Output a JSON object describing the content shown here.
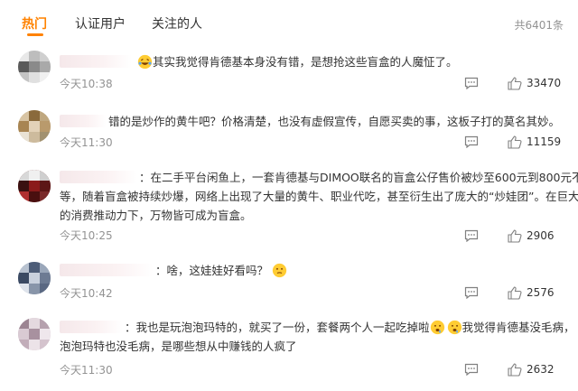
{
  "tabs": {
    "hot": "热门",
    "verified": "认证用户",
    "following": "关注的人"
  },
  "total": "共6401条",
  "comments": [
    {
      "text": "其实我觉得肯德基本身没有错，是想抢这些盲盒的人魔怔了。",
      "time": "今天10:38",
      "likes": "33470",
      "emoji": "laughing-tears-icon"
    },
    {
      "text": "错的是炒作的黄牛吧？价格清楚，也没有虚假宣传，自愿买卖的事，这板子打的莫名其妙。",
      "time": "今天11:30",
      "likes": "11159"
    },
    {
      "line1": "：在二手平台闲鱼上，一套肯德基与DIMOO联名的盲盒公仔售价被炒至600元到800元不",
      "line2": "等，随着盲盒被持续炒爆，网络上出现了大量的黄牛、职业代吃，甚至衍生出了庞大的“炒娃团”。在巨大",
      "line3": "的消费推动力下，万物皆可成为盲盒。",
      "time": "今天10:25",
      "likes": "2906"
    },
    {
      "text": "：啥，这娃娃好看吗？",
      "time": "今天10:42",
      "likes": "2576",
      "emoji": "thinking-face-icon"
    },
    {
      "line1a": "：我也是玩泡泡玛特的，就买了一份，套餐两个人一起吃掉啦",
      "line1b": "我觉得肯德基没毛病，",
      "line2": "泡泡玛特也没毛病，是哪些想从中赚钱的人疯了",
      "time": "今天11:30",
      "likes": "2632"
    }
  ],
  "colors": {
    "accent": "#ff8200",
    "muted": "#939393",
    "text": "#333333"
  }
}
